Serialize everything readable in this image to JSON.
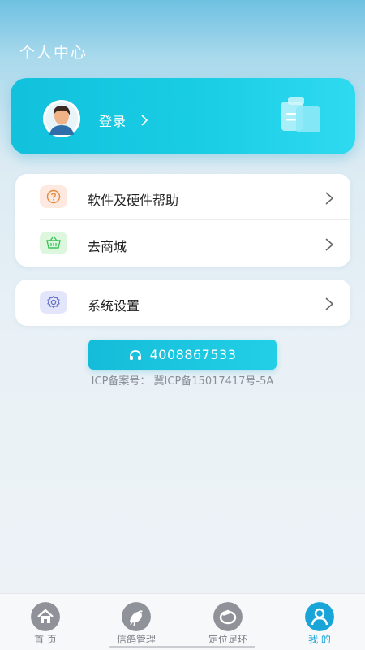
{
  "header": {
    "title": "个人中心"
  },
  "profile": {
    "login_label": "登录"
  },
  "menu": {
    "items": [
      {
        "label": "软件及硬件帮助",
        "icon": "help-icon",
        "icon_bg": "#fde9df",
        "icon_color": "#e68a3c"
      },
      {
        "label": "去商城",
        "icon": "basket-icon",
        "icon_bg": "#ddf7de",
        "icon_color": "#3cc25a"
      },
      {
        "label": "系统设置",
        "icon": "gear-icon",
        "icon_bg": "#e3e6fb",
        "icon_color": "#6470c8"
      }
    ]
  },
  "contact": {
    "phone": "4008867533",
    "icp": "ICP备案号： 冀ICP备15017417号-5A"
  },
  "tabbar": {
    "tabs": [
      {
        "label": "首 页",
        "icon": "home-icon"
      },
      {
        "label": "信鸽管理",
        "icon": "pigeon-icon"
      },
      {
        "label": "定位足环",
        "icon": "ring-icon"
      },
      {
        "label": "我 的",
        "icon": "user-icon",
        "active": true
      }
    ]
  },
  "colors": {
    "accent": "#1aa5d9",
    "card_gradient_start": "#12c1dc",
    "card_gradient_end": "#2fdaf0"
  }
}
